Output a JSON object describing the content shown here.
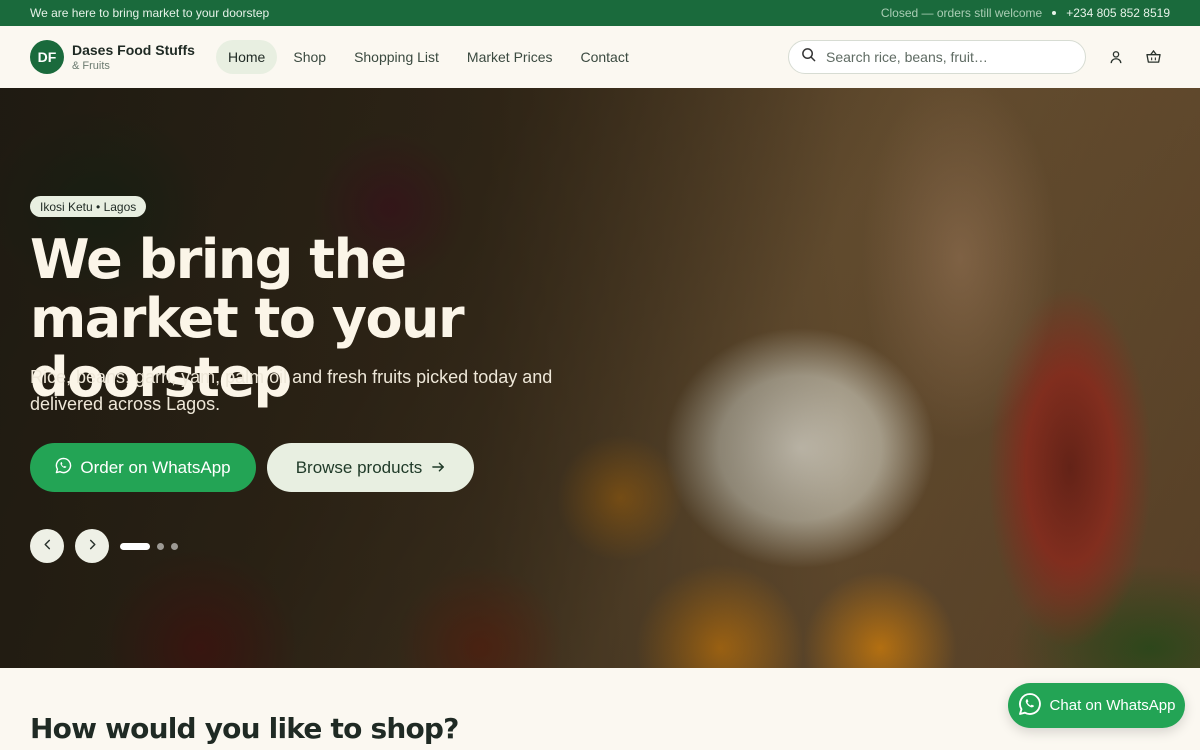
{
  "topbar": {
    "tagline": "We are here to bring market to your doorstep",
    "status": "Closed — orders still welcome",
    "phone": "+234 805 852 8519"
  },
  "brand": {
    "initials": "DF",
    "name": "Dases Food Stuffs",
    "sub": "& Fruits",
    "color": "#1a6a3c"
  },
  "nav": {
    "items": [
      {
        "label": "Home",
        "active": true
      },
      {
        "label": "Shop"
      },
      {
        "label": "Shopping List"
      },
      {
        "label": "Market Prices"
      },
      {
        "label": "Contact"
      }
    ]
  },
  "search": {
    "placeholder": "Search rice, beans, fruit…",
    "value": ""
  },
  "header_icons": [
    "user-icon",
    "basket-icon"
  ],
  "hero": {
    "location": "Ikosi Ketu • Lagos",
    "headline": "We bring the market to your doorstep",
    "subtext": "Rice, beans, garri, yam, palm oil and fresh fruits picked today and delivered across Lagos.",
    "primary_cta": "Order on WhatsApp",
    "secondary_cta": "Browse products",
    "slides_total": 3,
    "slide_active": 1
  },
  "section": {
    "title": "How would you like to shop?"
  },
  "floating_cta": {
    "label": "Chat on WhatsApp",
    "color": "#23a455"
  }
}
